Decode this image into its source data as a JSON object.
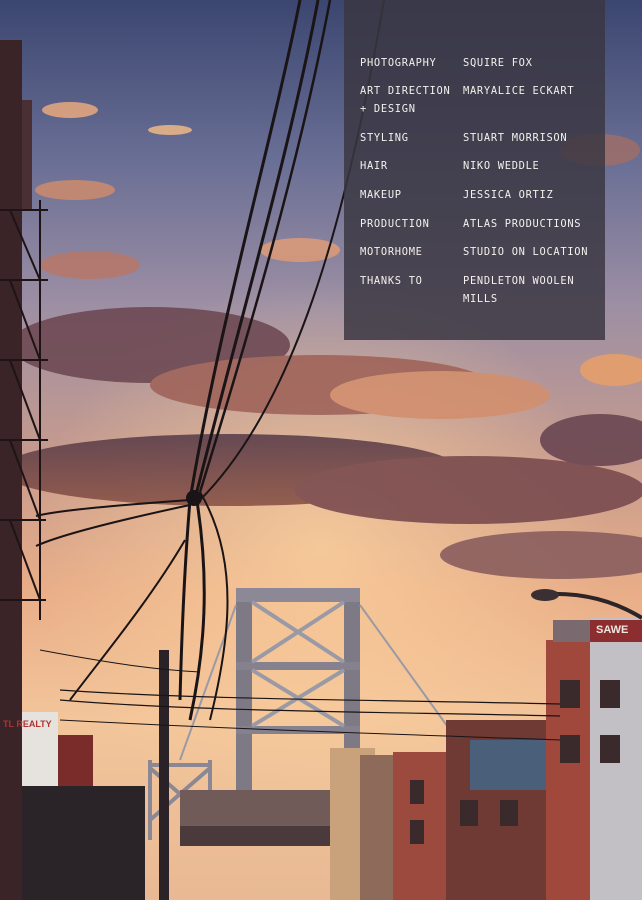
{
  "credits": [
    {
      "role": "PHOTOGRAPHY",
      "name": "SQUIRE FOX"
    },
    {
      "role": "ART DIRECTION",
      "role_line2": "+ DESIGN",
      "name": "MARYALICE ECKART"
    },
    {
      "role": "STYLING",
      "name": "STUART MORRISON"
    },
    {
      "role": "HAIR",
      "name": "NIKO WEDDLE"
    },
    {
      "role": "MAKEUP",
      "name": "JESSICA ORTIZ"
    },
    {
      "role": "PRODUCTION",
      "name": "ATLAS PRODUCTIONS"
    },
    {
      "role": "MOTORHOME",
      "name": "STUDIO ON LOCATION"
    },
    {
      "role": "THANKS TO",
      "name": "PENDLETON WOOLEN",
      "name_line2": "MILLS"
    }
  ],
  "signage": {
    "realty_sign": "TL REALTY",
    "graffiti_top": "SAWE"
  },
  "colors": {
    "panel": "#3a3742",
    "text": "#f4f1ee",
    "sky_top": "#3e4c74",
    "sky_glow": "#f0b07a"
  }
}
